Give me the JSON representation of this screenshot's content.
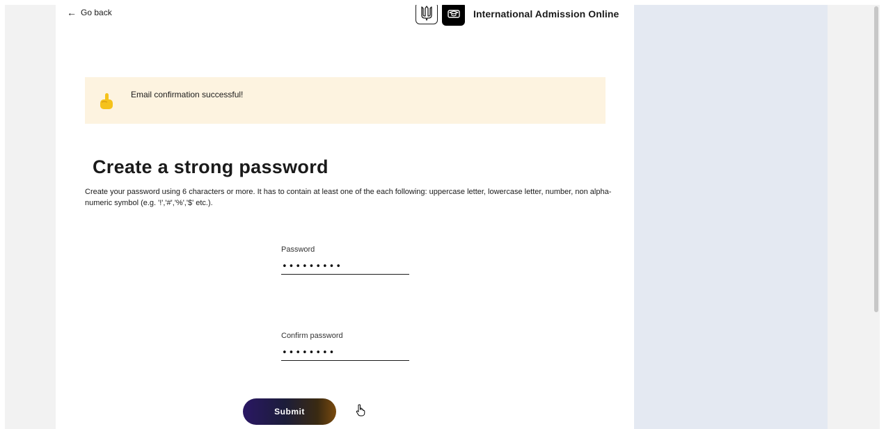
{
  "nav": {
    "back_label": "Go back"
  },
  "brand": {
    "title": "International Admission Online"
  },
  "alert": {
    "message": "Email confirmation successful!"
  },
  "form": {
    "heading": "Create a strong password",
    "description": "Create your password using 6 characters or more. It has to contain at least one of the each following: uppercase letter, lowercase letter, number, non alpha-numeric symbol (e.g. '!','#','%','$' etc.).",
    "password": {
      "label": "Password",
      "value": "passw0rd!"
    },
    "confirm_password": {
      "label": "Confirm password",
      "value": "passw0rd"
    },
    "submit_label": "Submit"
  },
  "icons": {
    "back": "arrow-left-icon",
    "emblem": "trident-emblem-icon",
    "logo": "graduation-cap-icon",
    "alert": "pointing-hand-icon"
  },
  "colors": {
    "alert_background": "#fdf3e0",
    "side_panel": "#e4e9f2",
    "button_gradient_start": "#2a1764",
    "button_gradient_end": "#7a4a0e"
  }
}
